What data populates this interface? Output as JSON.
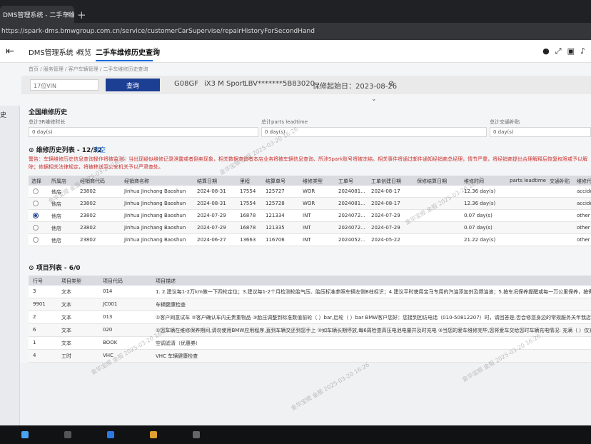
{
  "browser": {
    "tab_title": "DMS管理系统 - 二手车维修历",
    "tab_close": "×",
    "new_tab": "+",
    "url": "https://spark-dms.bmwgroup.com.cn/service/customerCarSupervise/repairHistoryForSecondHand"
  },
  "header": {
    "system_title": "DMS管理系统 ›",
    "overview": "概览",
    "active_tab": "二手车维修历史查询",
    "active_tab_close": "×"
  },
  "breadcrumb": "首页 / 服务管理 / 客户车辆管理 / 二手车维修历史查询",
  "search": {
    "vin_placeholder": "17位VIN",
    "query_label": "查询",
    "model_code": "G08GF",
    "model_name": "iX3 M Sport",
    "vin_masked": "LBV*******5B83020",
    "warranty_start": "保修起始日：2023-08-26",
    "link_icon": "⊘",
    "expand": "⌄"
  },
  "national": {
    "title": "全国维修历史",
    "stats": [
      {
        "label": "总计3R维修时长",
        "value": "0 day(s)"
      },
      {
        "label": "总计parts leadtime",
        "value": "0 day(s)"
      },
      {
        "label": "总计交通补贴",
        "value": "0 day(s)"
      }
    ]
  },
  "history": {
    "title": "维修历史列表 - 12/32",
    "clear": "清空",
    "warning": "警告：车辆维修历史信息查询操作将被监测。当出现疑似维修记录泄露或者倒卖现象，相关数据查询者本店业务将被车辆信息查询、所涉Spark账号将被冻结。相关事件将通过邮件通知经销商总经理，情节严重，将经销商提出合理解释后恢复权限或予以解除；依据相关法律规定，将被移送至公安机关予以严肃查处。",
    "columns": [
      "选择",
      "所属店",
      "经销商代码",
      "经销商名称",
      "结算日期",
      "里程",
      "结算单号",
      "维修类型",
      "工单号",
      "工单创建日期",
      "保修结算日期",
      "维修时间",
      "parts leadtime",
      "交通补贴",
      "维修代"
    ],
    "rows": [
      {
        "selected": false,
        "store": "他店",
        "code": "23802",
        "name": "Jinhua Jinchang Baoshun",
        "settle_date": "2024-08-31",
        "mileage": "17554",
        "settle_no": "125727",
        "type": "WOR",
        "wo_no": "2024081...",
        "wo_date": "2024-08-17",
        "warranty_date": "",
        "repair_time": "12.36 day(s)",
        "leadtime": "",
        "subsidy": "",
        "extra": "accide"
      },
      {
        "selected": false,
        "store": "他店",
        "code": "23802",
        "name": "Jinhua Jinchang Baoshun",
        "settle_date": "2024-08-31",
        "mileage": "17554",
        "settle_no": "125728",
        "type": "WOR",
        "wo_no": "2024081...",
        "wo_date": "2024-08-17",
        "warranty_date": "",
        "repair_time": "12.36 day(s)",
        "leadtime": "",
        "subsidy": "",
        "extra": "accide"
      },
      {
        "selected": true,
        "store": "他店",
        "code": "23802",
        "name": "Jinhua Jinchang Baoshun",
        "settle_date": "2024-07-29",
        "mileage": "16878",
        "settle_no": "121334",
        "type": "INT",
        "wo_no": "2024072...",
        "wo_date": "2024-07-29",
        "warranty_date": "",
        "repair_time": "0.07 day(s)",
        "leadtime": "",
        "subsidy": "",
        "extra": "other"
      },
      {
        "selected": false,
        "store": "他店",
        "code": "23802",
        "name": "Jinhua Jinchang Baoshun",
        "settle_date": "2024-07-29",
        "mileage": "16878",
        "settle_no": "121335",
        "type": "INT",
        "wo_no": "2024072...",
        "wo_date": "2024-07-29",
        "warranty_date": "",
        "repair_time": "0.07 day(s)",
        "leadtime": "",
        "subsidy": "",
        "extra": "other"
      },
      {
        "selected": false,
        "store": "他店",
        "code": "23802",
        "name": "Jinhua Jinchang Baoshun",
        "settle_date": "2024-06-27",
        "mileage": "13663",
        "settle_no": "116706",
        "type": "INT",
        "wo_no": "2024052...",
        "wo_date": "2024-05-22",
        "warranty_date": "",
        "repair_time": "21.22 day(s)",
        "leadtime": "",
        "subsidy": "",
        "extra": "other"
      }
    ]
  },
  "items": {
    "title": "项目列表 - 6/0",
    "columns": [
      "行号",
      "项目类型",
      "项目代码",
      "项目描述"
    ],
    "rows": [
      {
        "line": "3",
        "type": "文本",
        "code": "014",
        "desc": "1. 2.建议每1-2万km做一下四轮定位；3.建议每1-2个月检测轮胎气压、胎压标准参照车辆左侧B柱标识；4.建议平时使用宝马专用的汽油添加剂及燃油液；5.按车况保养提醒或每一万公里保养，按需保养，"
      },
      {
        "line": "9901",
        "type": "文本",
        "code": "JC001",
        "desc": "车辆健康检查"
      },
      {
        "line": "2",
        "type": "文本",
        "code": "013",
        "desc": "①客户同意试车 ②客户确认车内无贵重物品 ③胎压调整到标准数值前轮（ ）bar,后轮（ ）bar BMW客户您好：您接到回访电话（010-50812207）时，请回答是;否会修您身边的常规服务关年我店体验值"
      },
      {
        "line": "6",
        "type": "文本",
        "code": "020",
        "desc": "①您车辆在维修保养期间,请勿使用BMW应用程序,直到车辆交还到您手上 ②如车辆长期停放,每6周检查高压电池电量并及时充电 ③当您的爱车维修完毕,您将爱车交给您时车辆充电情况: 充满（ ）仅充满"
      },
      {
        "line": "1",
        "type": "文本",
        "code": "BOOK",
        "desc": "空调滤清（优惠券）"
      },
      {
        "line": "4",
        "type": "工时",
        "code": "VHC",
        "desc": "VHC 车辆健康检查"
      }
    ]
  },
  "watermark": "金华宝顺 金服 2025-03-20 16:26",
  "colors": {
    "brand": "#1c3f94",
    "warning": "#c9302c",
    "accent": "#1c69d4"
  }
}
